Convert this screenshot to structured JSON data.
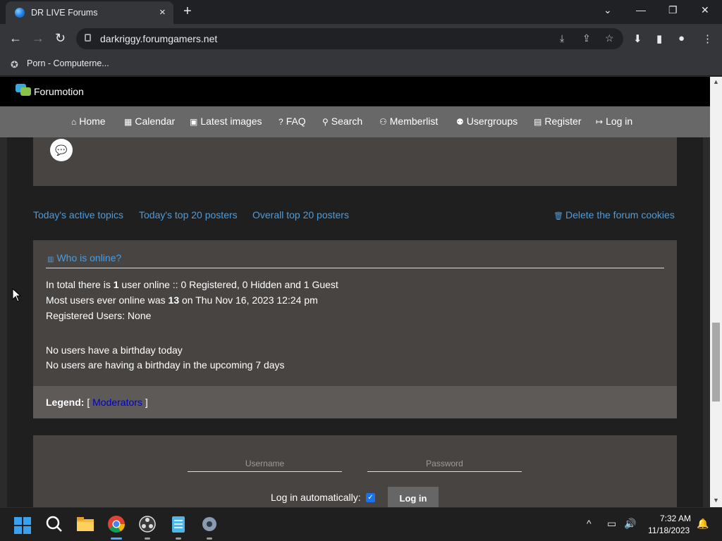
{
  "browser": {
    "tab_title": "DR LIVE Forums",
    "url": "darkriggy.forumgamers.net",
    "bookmark_label": "Porn - Computerne...",
    "icons": {
      "tab_close": "×",
      "new_tab": "+",
      "back": "←",
      "forward": "→",
      "reload": "↻",
      "install": "⤓",
      "share": "⇪",
      "star": "☆",
      "download": "⬇",
      "sidepanel": "▮",
      "profile": "●",
      "menu": "⋮",
      "minimize": "—",
      "restore": "❐",
      "close": "✕",
      "tabsearch": "⌄"
    }
  },
  "forum": {
    "brand": "Forumotion",
    "nav": [
      {
        "icon": "⌂",
        "label": "Home"
      },
      {
        "icon": "▦",
        "label": "Calendar"
      },
      {
        "icon": "▣",
        "label": "Latest images"
      },
      {
        "icon": "?",
        "label": "FAQ"
      },
      {
        "icon": "⚲",
        "label": "Search"
      },
      {
        "icon": "⚇",
        "label": "Memberlist"
      },
      {
        "icon": "⚉",
        "label": "Usergroups"
      },
      {
        "icon": "▤",
        "label": "Register"
      },
      {
        "icon": "↦",
        "label": "Log in"
      }
    ],
    "links": {
      "active_topics": "Today's active topics",
      "top20_today": "Today's top 20 posters",
      "top20_overall": "Overall top 20 posters",
      "delete_cookies": "Delete the forum cookies",
      "delete_icon": "🗑"
    },
    "who": {
      "title": "Who is online?",
      "title_icon": "▥",
      "line1_a": "In total there is ",
      "line1_b": "1",
      "line1_c": " user online :: 0 Registered, 0 Hidden and 1 Guest",
      "line2_a": "Most users ever online was ",
      "line2_b": "13",
      "line2_c": " on Thu Nov 16, 2023 12:24 pm",
      "line3": "Registered Users: None",
      "line4": "No users have a birthday today",
      "line5": "No users are having a birthday in the upcoming 7 days",
      "legend_label": "Legend:",
      "legend_open": " [ ",
      "legend_mod": "Moderators",
      "legend_close": " ]"
    },
    "login": {
      "username_placeholder": "Username",
      "password_placeholder": "Password",
      "auto_label": "Log in automatically:",
      "checkmark": "✓",
      "button": "Log in"
    },
    "bubble_icon": "💬"
  },
  "taskbar": {
    "time": "7:32 AM",
    "date": "11/18/2023",
    "chevron": "^",
    "network": "▭",
    "volume": "🔊",
    "notification": "🔔"
  }
}
